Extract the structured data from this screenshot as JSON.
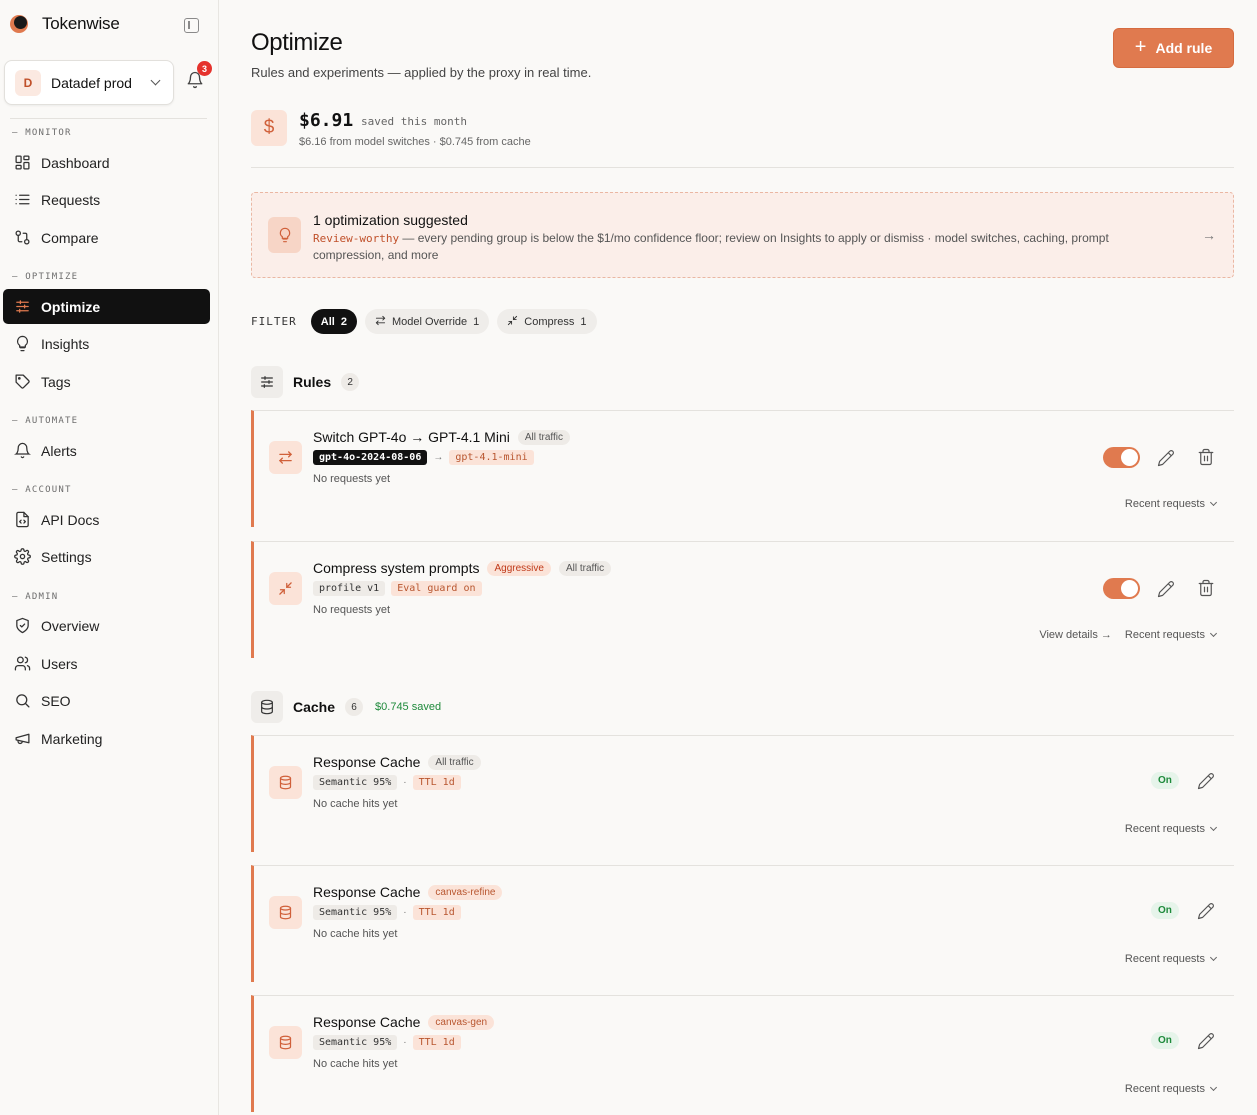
{
  "app": {
    "name": "Tokenwise"
  },
  "workspace": {
    "initial": "D",
    "name": "Datadef prod",
    "notifications": "3"
  },
  "sidebar": {
    "sections": [
      {
        "label": "— MONITOR",
        "items": [
          {
            "label": "Dashboard",
            "icon": "dashboard-icon"
          },
          {
            "label": "Requests",
            "icon": "list-icon"
          },
          {
            "label": "Compare",
            "icon": "compare-icon"
          }
        ]
      },
      {
        "label": "— OPTIMIZE",
        "items": [
          {
            "label": "Optimize",
            "icon": "sliders-icon",
            "active": true
          },
          {
            "label": "Insights",
            "icon": "lightbulb-icon"
          },
          {
            "label": "Tags",
            "icon": "tag-icon"
          }
        ]
      },
      {
        "label": "— AUTOMATE",
        "items": [
          {
            "label": "Alerts",
            "icon": "bell-icon"
          }
        ]
      },
      {
        "label": "— ACCOUNT",
        "items": [
          {
            "label": "API Docs",
            "icon": "file-code-icon"
          },
          {
            "label": "Settings",
            "icon": "gear-icon"
          }
        ]
      },
      {
        "label": "— ADMIN",
        "items": [
          {
            "label": "Overview",
            "icon": "shield-icon"
          },
          {
            "label": "Users",
            "icon": "users-icon"
          },
          {
            "label": "SEO",
            "icon": "search-icon"
          },
          {
            "label": "Marketing",
            "icon": "megaphone-icon"
          }
        ]
      }
    ]
  },
  "page": {
    "title": "Optimize",
    "subtitle": "Rules and experiments — applied by the proxy in real time.",
    "add_button": "Add rule"
  },
  "savings": {
    "amount": "$6.91",
    "label": "saved this month",
    "breakdown": "$6.16 from model switches · $0.745 from cache"
  },
  "suggestion": {
    "title": "1 optimization suggested",
    "tag": "Review-worthy",
    "desc": " — every pending group is below the $1/mo confidence floor; review on Insights to apply or dismiss · model switches, caching, prompt compression, and more"
  },
  "filter": {
    "label": "FILTER",
    "chips": [
      {
        "label": "All",
        "count": "2",
        "active": true
      },
      {
        "label": "Model Override",
        "count": "1",
        "icon": "swap-icon"
      },
      {
        "label": "Compress",
        "count": "1",
        "icon": "compress-icon"
      }
    ]
  },
  "rules": {
    "title": "Rules",
    "count": "2",
    "items": [
      {
        "title": "Switch GPT-4o → GPT-4.1 Mini",
        "scope": "All traffic",
        "from_model": "gpt-4o-2024-08-06",
        "to_model": "gpt-4.1-mini",
        "status": "No requests yet",
        "recent": "Recent requests"
      },
      {
        "title": "Compress system prompts",
        "level": "Aggressive",
        "scope": "All traffic",
        "profile": "profile v1",
        "guard": "Eval guard on",
        "status": "No requests yet",
        "details": "View details →",
        "recent": "Recent requests"
      }
    ]
  },
  "cache": {
    "title": "Cache",
    "count": "6",
    "saved": "$0.745 saved",
    "items": [
      {
        "title": "Response Cache",
        "scope": "All traffic",
        "semantic": "Semantic 95%",
        "ttl": "TTL 1d",
        "status": "No cache hits yet",
        "state": "On",
        "recent": "Recent requests"
      },
      {
        "title": "Response Cache",
        "scope": "canvas-refine",
        "semantic": "Semantic 95%",
        "ttl": "TTL 1d",
        "status": "No cache hits yet",
        "state": "On",
        "recent": "Recent requests"
      },
      {
        "title": "Response Cache",
        "scope": "canvas-gen",
        "semantic": "Semantic 95%",
        "ttl": "TTL 1d",
        "status": "No cache hits yet",
        "state": "On",
        "recent": "Recent requests"
      }
    ]
  },
  "colors": {
    "accent": "#e07a4f",
    "accent_soft": "#fbe3d8",
    "active_nav": "#111111",
    "success": "#1e8a3b",
    "danger": "#e5322d"
  }
}
